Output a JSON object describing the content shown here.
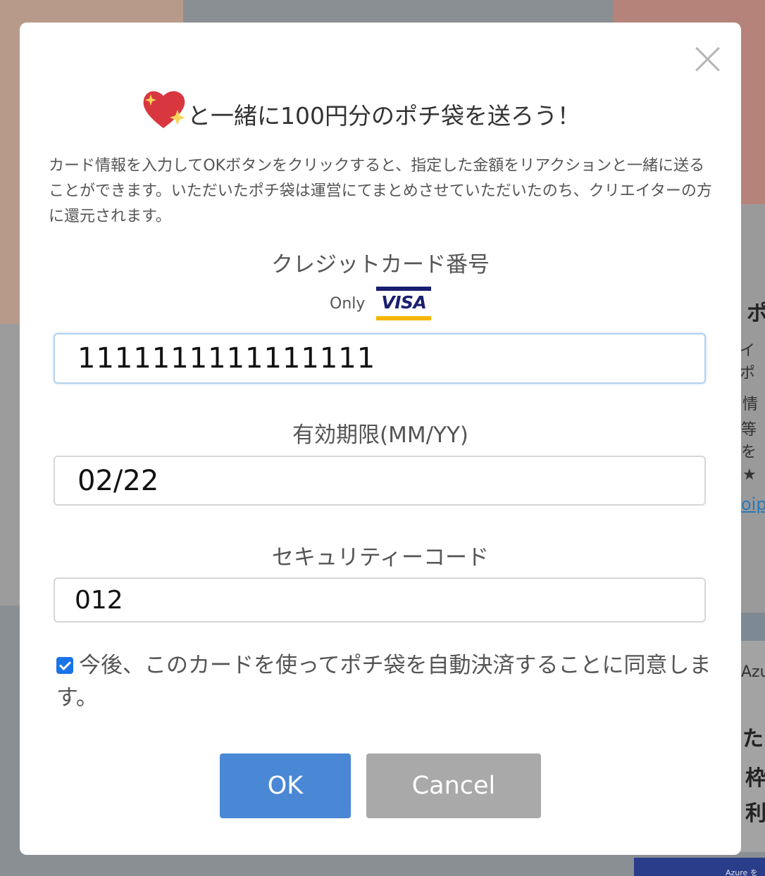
{
  "dialog": {
    "title": "と一緒に100円分のポチ袋を送ろう！",
    "description": "カード情報を入力してOKボタンをクリックすると、指定した金額をリアクションと一緒に送ることができます。いただいたポチ袋は運営にてまとめさせていただいたのち、クリエイターの方に還元されます。",
    "card_number": {
      "label": "クレジットカード番号",
      "only_text": "Only",
      "brand_logo": "VISA",
      "value": "1111111111111111"
    },
    "expiry": {
      "label": "有効期限(MM/YY)",
      "value": "02/22"
    },
    "security_code": {
      "label": "セキュリティーコード",
      "value": "012"
    },
    "consent": {
      "checked": true,
      "text": "今後、このカードを使ってポチ袋を自動決済することに同意します。"
    },
    "ok_label": "OK",
    "cancel_label": "Cancel"
  },
  "background": {
    "ad_text": "Azure を無",
    "fragments": [
      "ポ",
      "イポ",
      "情",
      "等を",
      "★",
      "oip",
      "Azu",
      "た",
      "枠",
      "利"
    ]
  },
  "icons": {
    "title_icon": "sparkling-heart-icon",
    "close_icon": "close-icon"
  },
  "colors": {
    "ok_button": "#4a87d4",
    "cancel_button": "#a9a9a9",
    "checkbox": "#1a73e8",
    "visa_blue": "#1a1f71",
    "visa_gold": "#f7b600"
  }
}
